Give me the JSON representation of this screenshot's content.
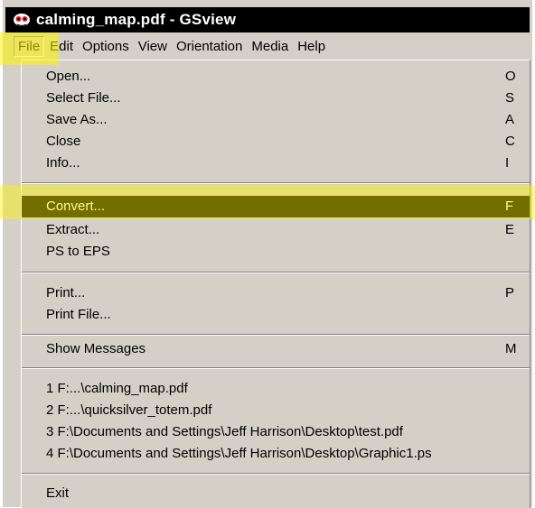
{
  "window": {
    "title": "calming_map.pdf - GSview"
  },
  "menubar": {
    "items": [
      "File",
      "Edit",
      "Options",
      "View",
      "Orientation",
      "Media",
      "Help"
    ]
  },
  "file_menu": {
    "items": [
      {
        "label": "Open...",
        "accel": "O"
      },
      {
        "label": "Select File...",
        "accel": "S"
      },
      {
        "label": "Save As...",
        "accel": "A"
      },
      {
        "label": "Close",
        "accel": "C"
      },
      {
        "label": "Info...",
        "accel": "I"
      },
      {
        "label": "Convert...",
        "accel": "F"
      },
      {
        "label": "Extract...",
        "accel": "E"
      },
      {
        "label": "PS to EPS",
        "accel": ""
      },
      {
        "label": "Print...",
        "accel": "P"
      },
      {
        "label": "Print File...",
        "accel": ""
      },
      {
        "label": "Show Messages",
        "accel": "M"
      },
      {
        "label": "1 F:...\\calming_map.pdf",
        "accel": ""
      },
      {
        "label": "2 F:...\\quicksilver_totem.pdf",
        "accel": ""
      },
      {
        "label": "3 F:\\Documents and Settings\\Jeff Harrison\\Desktop\\test.pdf",
        "accel": ""
      },
      {
        "label": "4 F:\\Documents and Settings\\Jeff Harrison\\Desktop\\Graphic1.ps",
        "accel": ""
      },
      {
        "label": "Exit",
        "accel": ""
      }
    ]
  },
  "colors": {
    "menu_bg": "#d4d0c8",
    "selected_bg": "#000000",
    "highlight": "#fff500"
  },
  "icons": {
    "app": "gsview-app-icon"
  }
}
